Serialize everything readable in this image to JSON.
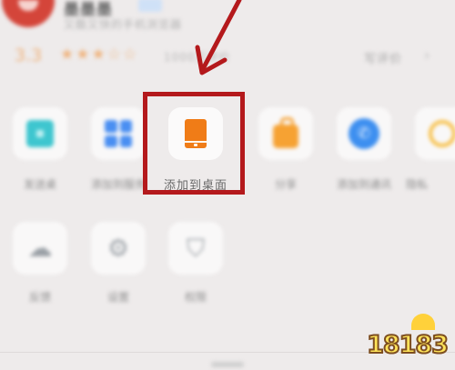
{
  "app": {
    "name": "墨墨墨",
    "description": "又酷又快的手机浏览器",
    "rating": "3.3",
    "stars": "★★★☆☆",
    "rating_count": "1000万评价",
    "review_link": "写评价",
    "chevron": "›"
  },
  "actions_row1": [
    {
      "label": "发送桌",
      "icon": "teal-square-icon"
    },
    {
      "label": "添加到服务",
      "icon": "grid-icon"
    },
    {
      "label": "添加到桌面",
      "icon": "add-to-desktop-icon"
    },
    {
      "label": "分享",
      "icon": "bag-icon"
    },
    {
      "label": "添加到通讯",
      "icon": "phone-circle-icon"
    },
    {
      "label": "隐私",
      "icon": "ring-icon"
    }
  ],
  "actions_row2": [
    {
      "label": "反馈",
      "icon": "feedback-icon"
    },
    {
      "label": "设置",
      "icon": "settings-icon"
    },
    {
      "label": "权限",
      "icon": "shield-icon"
    }
  ],
  "icon_glyphs": {
    "phone": "✆",
    "feedback": "☁",
    "settings": "⚙",
    "shield": "⛉"
  },
  "colors": {
    "highlight": "#b4191c",
    "accent_orange": "#f07c17",
    "background": "#eeebeb"
  },
  "watermark": "18183"
}
